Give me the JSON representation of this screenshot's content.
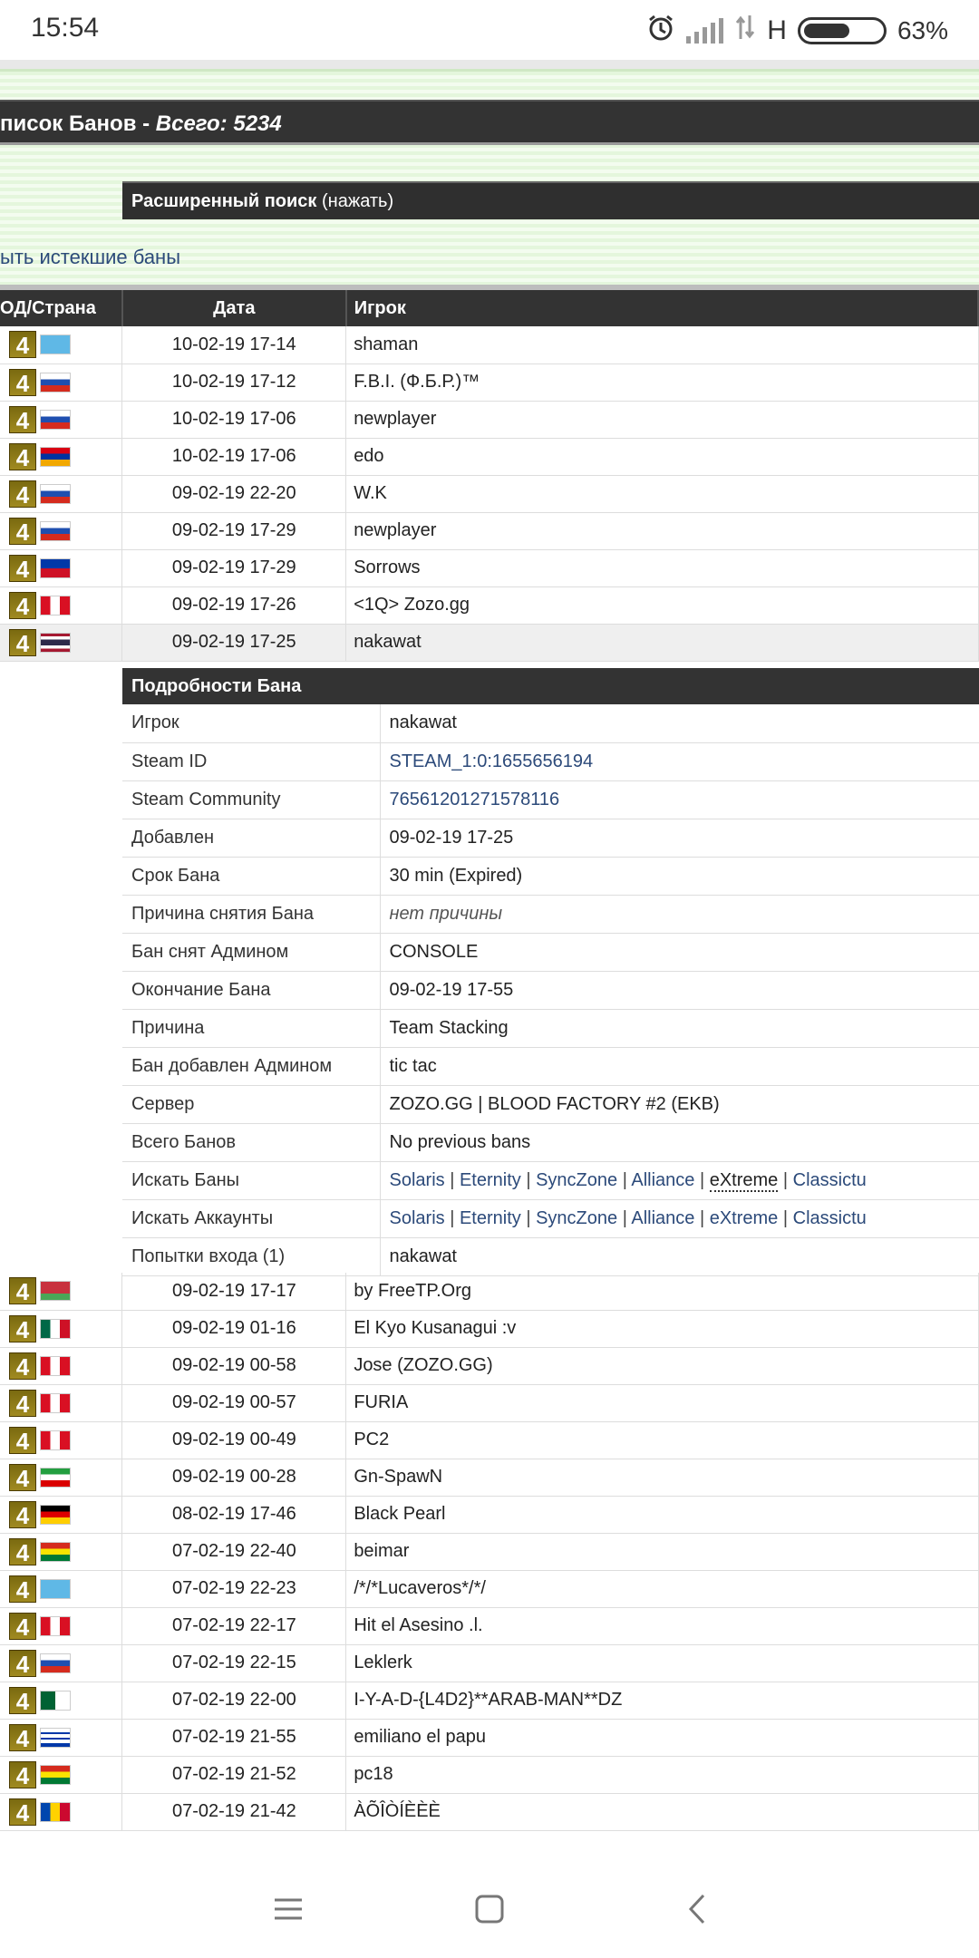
{
  "status": {
    "time": "15:54",
    "net": "H",
    "battery": "63%",
    "battery_level": 0.63
  },
  "page": {
    "title_prefix": "писок Банов - ",
    "title_total": "Всего: 5234",
    "adv_bold": "Расширенный поиск",
    "adv_rest": " (нажать)",
    "expired_link": "ыть истекшие баны"
  },
  "table": {
    "headers": {
      "mod": "ОД/Страна",
      "date": "Дата",
      "player": "Игрок"
    },
    "mod_icon_text": "4",
    "rows_top": [
      {
        "date": "10-02-19 17-14",
        "player": "shaman",
        "flag": "kz"
      },
      {
        "date": "10-02-19 17-12",
        "player": "F.B.I. (Ф.Б.Р.)™",
        "flag": "ru"
      },
      {
        "date": "10-02-19 17-06",
        "player": "newplayer",
        "flag": "ru"
      },
      {
        "date": "10-02-19 17-06",
        "player": "edo",
        "flag": "am"
      },
      {
        "date": "09-02-19 22-20",
        "player": "W.K",
        "flag": "ru"
      },
      {
        "date": "09-02-19 17-29",
        "player": "newplayer",
        "flag": "ru"
      },
      {
        "date": "09-02-19 17-29",
        "player": "Sorrows",
        "flag": "ph"
      },
      {
        "date": "09-02-19 17-26",
        "player": "<1Q> Zozo.gg",
        "flag": "pe"
      },
      {
        "date": "09-02-19 17-25",
        "player": "nakawat",
        "flag": "th"
      }
    ],
    "rows_bottom": [
      {
        "date": "09-02-19 17-17",
        "player": "by FreeTP.Org",
        "flag": "by"
      },
      {
        "date": "09-02-19 01-16",
        "player": "El Kyo Kusanagui :v",
        "flag": "mx"
      },
      {
        "date": "09-02-19 00-58",
        "player": "Jose (ZOZO.GG)",
        "flag": "pe"
      },
      {
        "date": "09-02-19 00-57",
        "player": "FURIA",
        "flag": "pe"
      },
      {
        "date": "09-02-19 00-49",
        "player": "PC2",
        "flag": "pe"
      },
      {
        "date": "09-02-19 00-28",
        "player": "Gn-SpawN",
        "flag": "ir"
      },
      {
        "date": "08-02-19 17-46",
        "player": "Black Pearl",
        "flag": "de"
      },
      {
        "date": "07-02-19 22-40",
        "player": "beimar",
        "flag": "bo"
      },
      {
        "date": "07-02-19 22-23",
        "player": "/*/*Lucaveros*/*/",
        "flag": "kz"
      },
      {
        "date": "07-02-19 22-17",
        "player": "Hit el Asesino .l.",
        "flag": "pe"
      },
      {
        "date": "07-02-19 22-15",
        "player": "Leklerk",
        "flag": "ru"
      },
      {
        "date": "07-02-19 22-00",
        "player": "I-Y-A-D-{L4D2}**ARAB-MAN**DZ",
        "flag": "dz"
      },
      {
        "date": "07-02-19 21-55",
        "player": "emiliano el papu",
        "flag": "uy"
      },
      {
        "date": "07-02-19 21-52",
        "player": "pc18",
        "flag": "bo"
      },
      {
        "date": "07-02-19 21-42",
        "player": "ÀÕÎÒÍÈÈÈ",
        "flag": "md"
      }
    ]
  },
  "details": {
    "header": "Подробности Бана",
    "player": {
      "k": "Игрок",
      "v": "nakawat"
    },
    "steamid": {
      "k": "Steam ID",
      "v": "STEAM_1:0:1655656194"
    },
    "community": {
      "k": "Steam Community",
      "v": "76561201271578116"
    },
    "added": {
      "k": "Добавлен",
      "v": "09-02-19 17-25"
    },
    "length": {
      "k": "Срок Бана",
      "v": "30 min (Expired)"
    },
    "unban_reason": {
      "k": "Причина снятия Бана",
      "v": "нет причины"
    },
    "unban_admin": {
      "k": "Бан снят Админом",
      "v": "CONSOLE"
    },
    "ends": {
      "k": "Окончание Бана",
      "v": "09-02-19 17-55"
    },
    "reason": {
      "k": "Причина",
      "v": "Team Stacking"
    },
    "admin": {
      "k": "Бан добавлен Админом",
      "v": "tic tac"
    },
    "server": {
      "k": "Сервер",
      "v": "ZOZO.GG | BLOOD FACTORY #2 (EKB)"
    },
    "total": {
      "k": "Всего Банов",
      "v": "No previous bans"
    },
    "search_bans": {
      "k": "Искать Баны",
      "links": [
        "Solaris",
        "Eternity",
        "SyncZone",
        "Alliance",
        "eXtreme",
        "Classictu"
      ]
    },
    "search_accounts": {
      "k": "Искать Аккаунты",
      "links": [
        "Solaris",
        "Eternity",
        "SyncZone",
        "Alliance",
        "eXtreme",
        "Classictu"
      ]
    },
    "login_attempts": {
      "k": "Попытки входа (1)",
      "v": "nakawat"
    }
  },
  "nav": {
    "icons": [
      "menu-icon",
      "home-square-icon",
      "back-chevron-icon"
    ]
  }
}
